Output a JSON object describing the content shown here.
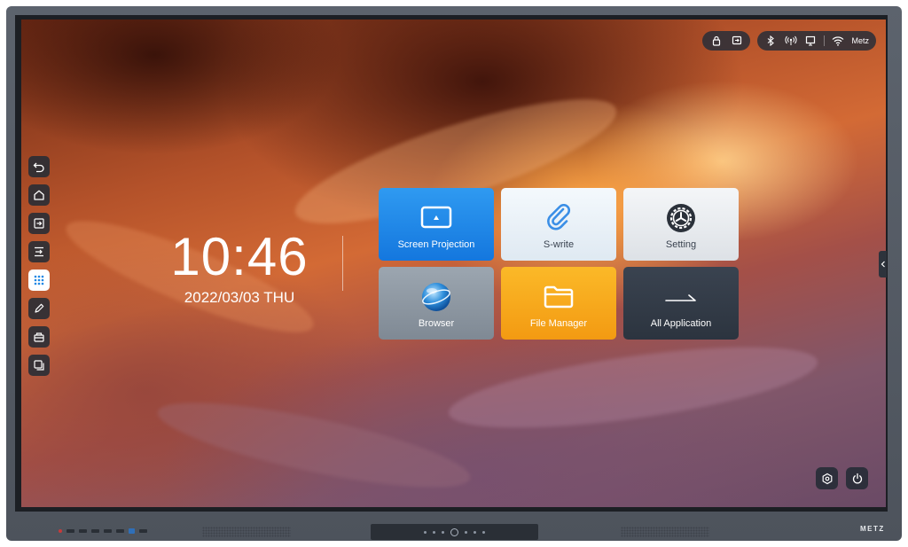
{
  "clock": {
    "time": "10:46",
    "date": "2022/03/03 THU"
  },
  "status_bar": {
    "left_pill": [
      "lock-icon",
      "input-source-icon"
    ],
    "right_pill": [
      "bluetooth-icon",
      "hotspot-icon",
      "display-icon",
      "wifi-icon"
    ],
    "network_name": "Metz"
  },
  "sidebar": {
    "items": [
      {
        "icon": "back-icon"
      },
      {
        "icon": "home-icon"
      },
      {
        "icon": "input-icon"
      },
      {
        "icon": "output-icon"
      },
      {
        "icon": "apps-grid-icon",
        "active": true
      },
      {
        "icon": "pen-icon"
      },
      {
        "icon": "toolbox-icon"
      },
      {
        "icon": "multi-window-icon"
      }
    ]
  },
  "tiles": {
    "screen_projection": "Screen Projection",
    "s_write": "S-write",
    "setting": "Setting",
    "browser": "Browser",
    "file_manager": "File Manager",
    "all_application": "All Application"
  },
  "device": {
    "brand": "METZ"
  },
  "colors": {
    "projection_tile": "#1f88e8",
    "file_tile": "#f6a81b",
    "all_apps_tile": "#333b47",
    "active_sidebar": "#1e88e5"
  }
}
